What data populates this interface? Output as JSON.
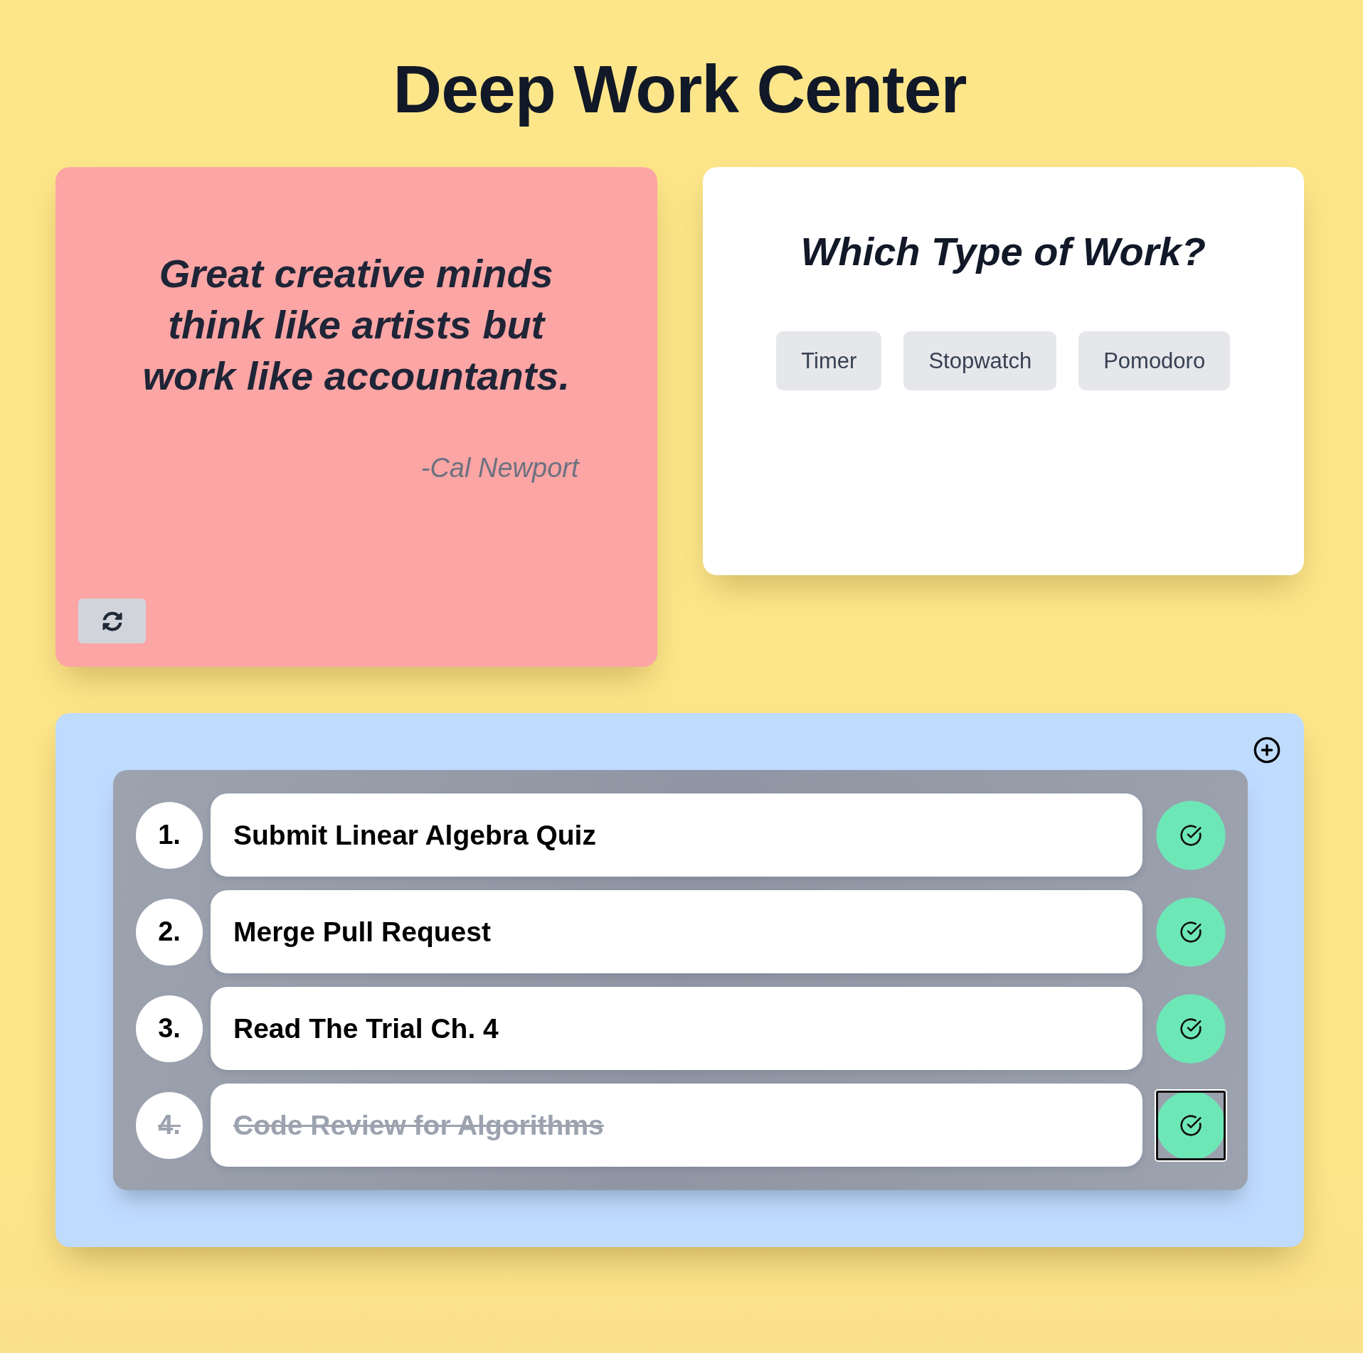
{
  "title": "Deep Work Center",
  "quote": {
    "text": "Great creative minds think like artists but work like accountants.",
    "author": "-Cal Newport"
  },
  "work_types": {
    "title": "Which Type of Work?",
    "options": [
      {
        "label": "Timer",
        "selected": false
      },
      {
        "label": "Stopwatch",
        "selected": false
      },
      {
        "label": "Pomodoro",
        "selected": false
      }
    ]
  },
  "tasks": [
    {
      "number": "1.",
      "text": "Submit Linear Algebra Quiz",
      "done": false,
      "focused": false
    },
    {
      "number": "2.",
      "text": "Merge Pull Request",
      "done": false,
      "focused": false
    },
    {
      "number": "3.",
      "text": "Read The Trial Ch. 4",
      "done": false,
      "focused": false
    },
    {
      "number": "4.",
      "text": "Code Review for Algorithms",
      "done": true,
      "focused": true
    }
  ]
}
